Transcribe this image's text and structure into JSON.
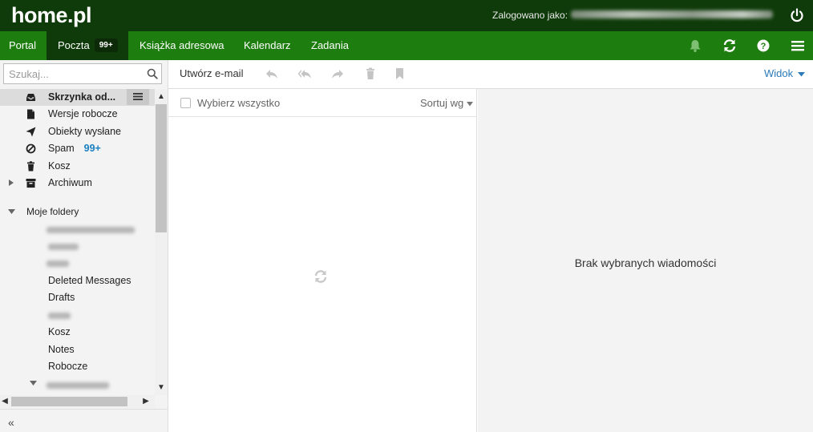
{
  "header": {
    "logo": "home.pl",
    "logged_in_label": "Zalogowano jako:"
  },
  "nav": {
    "items": [
      {
        "label": "Portal"
      },
      {
        "label": "Poczta",
        "badge": "99+"
      },
      {
        "label": "Książka adresowa"
      },
      {
        "label": "Kalendarz"
      },
      {
        "label": "Zadania"
      }
    ],
    "icons": [
      "bell-icon",
      "refresh-icon",
      "help-icon",
      "menu-icon"
    ]
  },
  "sidebar": {
    "search_placeholder": "Szukaj...",
    "folders": [
      {
        "label": "Skrzynka od...",
        "icon": "inbox-icon",
        "selected": true
      },
      {
        "label": "Wersje robocze",
        "icon": "draft-icon"
      },
      {
        "label": "Obiekty wysłane",
        "icon": "send-icon"
      },
      {
        "label": "Spam",
        "icon": "spam-icon",
        "count": "99+"
      },
      {
        "label": "Kosz",
        "icon": "trash-icon"
      },
      {
        "label": "Archiwum",
        "icon": "archive-icon"
      }
    ],
    "section_label": "Moje foldery",
    "custom_folders": [
      "Deleted Messages",
      "Drafts",
      "Kosz",
      "Notes",
      "Robocze"
    ],
    "collapse_label": "«"
  },
  "toolbar": {
    "compose_label": "Utwórz e-mail",
    "view_label": "Widok"
  },
  "list": {
    "select_all_label": "Wybierz wszystko",
    "sort_label": "Sortuj wg"
  },
  "preview": {
    "empty_text": "Brak wybranych wiadomości"
  },
  "colors": {
    "top_bar": "#0f3b0a",
    "nav_bar": "#1e7d0f",
    "accent_link": "#2a7ab9",
    "count": "#1a7fc1"
  }
}
